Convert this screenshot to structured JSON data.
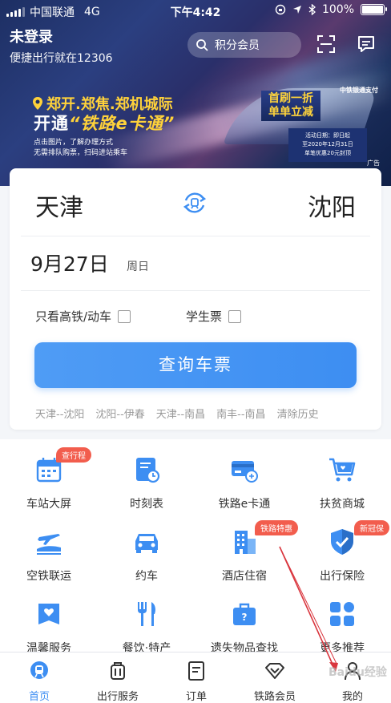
{
  "status": {
    "carrier": "中国联通",
    "network": "4G",
    "time": "下午4:42",
    "battery": "100%"
  },
  "header": {
    "title": "未登录",
    "subtitle": "便捷出行就在12306",
    "search_label": "积分会员"
  },
  "banner": {
    "cities": "郑开.郑焦.郑机城际",
    "open_prefix": "开通",
    "open_highlight": "“铁路e卡通”",
    "note1": "点击图片，了解办理方式",
    "note2": "无需排队购票，扫码进站乘车",
    "badge_line1": "首刷一折",
    "badge_line2": "单单立减",
    "pay": "中铁银通支付",
    "event1": "活动日期：即日起",
    "event2": "至2020年12月31日",
    "event3": "单笔优惠20元封顶",
    "ad": "广告"
  },
  "ticket": {
    "from": "天津",
    "to": "沈阳",
    "date": "9月27日",
    "weekday": "周日",
    "option_highspeed": "只看高铁/动车",
    "option_student": "学生票",
    "query_button": "查询车票",
    "history": [
      "天津--沈阳",
      "沈阳--伊春",
      "天津--南昌",
      "南丰--南昌"
    ],
    "clear_history": "清除历史"
  },
  "services": [
    {
      "label": "车站大屏",
      "tag": "查行程"
    },
    {
      "label": "时刻表"
    },
    {
      "label": "铁路e卡通"
    },
    {
      "label": "扶贫商城"
    },
    {
      "label": "空铁联运"
    },
    {
      "label": "约车"
    },
    {
      "label": "酒店住宿",
      "tag": "铁路特惠"
    },
    {
      "label": "出行保险",
      "tag": "新冠保"
    },
    {
      "label": "温馨服务"
    },
    {
      "label": "餐饮·特产"
    },
    {
      "label": "遗失物品查找"
    },
    {
      "label": "更多推荐"
    }
  ],
  "tabs": [
    {
      "label": "首页",
      "active": true
    },
    {
      "label": "出行服务"
    },
    {
      "label": "订单"
    },
    {
      "label": "铁路会员"
    },
    {
      "label": "我的"
    }
  ],
  "watermark": "Baidu经验",
  "colors": {
    "accent": "#3d8ef2",
    "tag_red": "#f25d4d",
    "promo_yellow": "#ffd23a"
  }
}
